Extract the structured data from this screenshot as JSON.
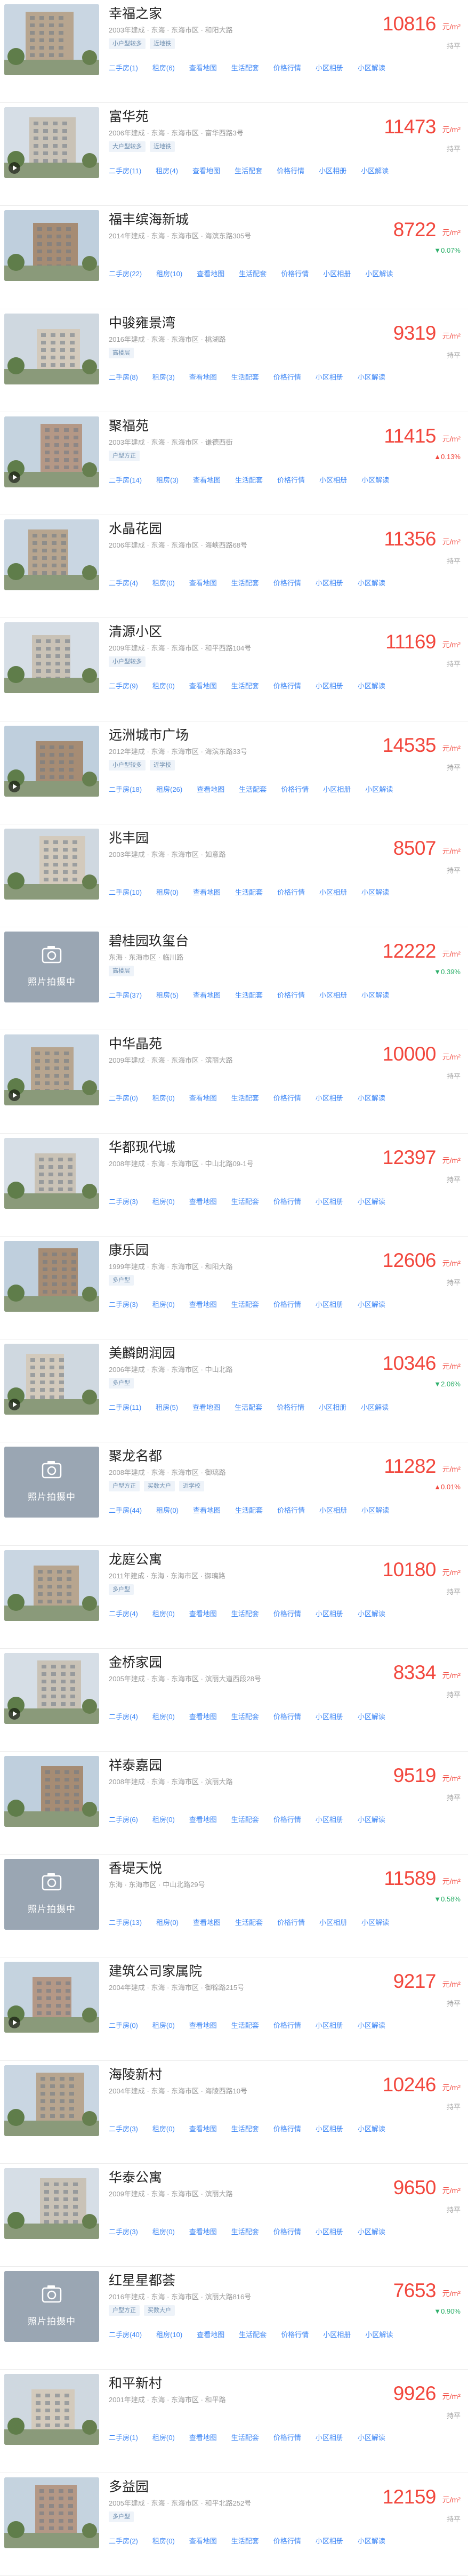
{
  "labels": {
    "unit": "元/m²",
    "trend_flat": "持平",
    "photo_placeholder": "照片拍摄中",
    "links": [
      "二手房",
      "租房",
      "查看地图",
      "生活配套",
      "价格行情",
      "小区相册",
      "小区解读"
    ]
  },
  "colors": {
    "price": "#f2473d",
    "link": "#3f87f5",
    "tag_text": "#6f8fb0",
    "tag_bg": "#eef3f9",
    "trend_down": "#2fb06b"
  },
  "communities": [
    {
      "name": "幸福之家",
      "meta": "2003年建成 · 东海 · 东海市区 · 和阳大路",
      "tags": [
        "小户型较多",
        "近地铁"
      ],
      "price": "10816",
      "trend": "持平",
      "trend_dir": "flat",
      "links": [
        "二手房(1)",
        "租房(6)",
        "查看地图",
        "生活配套",
        "价格行情",
        "小区相册",
        "小区解读"
      ],
      "photo": true
    },
    {
      "name": "富华苑",
      "meta": "2006年建成 · 东海 · 东海市区 · 富华西路3号",
      "tags": [
        "大户型较多",
        "近地铁"
      ],
      "price": "11473",
      "trend": "持平",
      "trend_dir": "flat",
      "links": [
        "二手房(11)",
        "租房(4)",
        "查看地图",
        "生活配套",
        "价格行情",
        "小区相册",
        "小区解读"
      ],
      "photo": true
    },
    {
      "name": "福丰缤海新城",
      "meta": "2014年建成 · 东海 · 东海市区 · 海滨东路305号",
      "tags": [],
      "price": "8722",
      "trend": "▼0.07%",
      "trend_dir": "down",
      "links": [
        "二手房(22)",
        "租房(10)",
        "查看地图",
        "生活配套",
        "价格行情",
        "小区相册",
        "小区解读"
      ],
      "photo": true
    },
    {
      "name": "中骏雍景湾",
      "meta": "2016年建成 · 东海 · 东海市区 · 桃湖路",
      "tags": [
        "高楼层"
      ],
      "price": "9319",
      "trend": "持平",
      "trend_dir": "flat",
      "links": [
        "二手房(8)",
        "租房(3)",
        "查看地图",
        "生活配套",
        "价格行情",
        "小区相册",
        "小区解读"
      ],
      "photo": true
    },
    {
      "name": "聚福苑",
      "meta": "2003年建成 · 东海 · 东海市区 · 谦德西街",
      "tags": [
        "户型方正"
      ],
      "price": "11415",
      "trend": "▲0.13%",
      "trend_dir": "up",
      "links": [
        "二手房(14)",
        "租房(3)",
        "查看地图",
        "生活配套",
        "价格行情",
        "小区相册",
        "小区解读"
      ],
      "photo": true
    },
    {
      "name": "水晶花园",
      "meta": "2006年建成 · 东海 · 东海市区 · 海峡西路68号",
      "tags": [],
      "price": "11356",
      "trend": "持平",
      "trend_dir": "flat",
      "links": [
        "二手房(4)",
        "租房(0)",
        "查看地图",
        "生活配套",
        "价格行情",
        "小区相册",
        "小区解读"
      ],
      "photo": true
    },
    {
      "name": "清源小区",
      "meta": "2009年建成 · 东海 · 东海市区 · 和平西路104号",
      "tags": [
        "小户型较多"
      ],
      "price": "11169",
      "trend": "持平",
      "trend_dir": "flat",
      "links": [
        "二手房(9)",
        "租房(0)",
        "查看地图",
        "生活配套",
        "价格行情",
        "小区相册",
        "小区解读"
      ],
      "photo": true
    },
    {
      "name": "远洲城市广场",
      "meta": "2012年建成 · 东海 · 东海市区 · 海滨东路33号",
      "tags": [
        "小户型较多",
        "近学校"
      ],
      "price": "14535",
      "trend": "持平",
      "trend_dir": "flat",
      "links": [
        "二手房(18)",
        "租房(26)",
        "查看地图",
        "生活配套",
        "价格行情",
        "小区相册",
        "小区解读"
      ],
      "photo": true
    },
    {
      "name": "兆丰园",
      "meta": "2003年建成 · 东海 · 东海市区 · 如意路",
      "tags": [],
      "price": "8507",
      "trend": "持平",
      "trend_dir": "flat",
      "links": [
        "二手房(10)",
        "租房(0)",
        "查看地图",
        "生活配套",
        "价格行情",
        "小区相册",
        "小区解读"
      ],
      "photo": true
    },
    {
      "name": "碧桂园玖玺台",
      "meta": "东海 · 东海市区 · 临川路",
      "tags": [
        "高楼层"
      ],
      "price": "12222",
      "trend": "▼0.39%",
      "trend_dir": "down",
      "links": [
        "二手房(37)",
        "租房(5)",
        "查看地图",
        "生活配套",
        "价格行情",
        "小区相册",
        "小区解读"
      ],
      "photo": false
    },
    {
      "name": "中华晶苑",
      "meta": "2009年建成 · 东海 · 东海市区 · 滨丽大路",
      "tags": [],
      "price": "10000",
      "trend": "持平",
      "trend_dir": "flat",
      "links": [
        "二手房(0)",
        "租房(0)",
        "查看地图",
        "生活配套",
        "价格行情",
        "小区相册",
        "小区解读"
      ],
      "photo": true
    },
    {
      "name": "华都现代城",
      "meta": "2008年建成 · 东海 · 东海市区 · 中山北路09-1号",
      "tags": [],
      "price": "12397",
      "trend": "持平",
      "trend_dir": "flat",
      "links": [
        "二手房(3)",
        "租房(0)",
        "查看地图",
        "生活配套",
        "价格行情",
        "小区相册",
        "小区解读"
      ],
      "photo": true
    },
    {
      "name": "康乐园",
      "meta": "1999年建成 · 东海 · 东海市区 · 和阳大路",
      "tags": [
        "多户型"
      ],
      "price": "12606",
      "trend": "持平",
      "trend_dir": "flat",
      "links": [
        "二手房(3)",
        "租房(0)",
        "查看地图",
        "生活配套",
        "价格行情",
        "小区相册",
        "小区解读"
      ],
      "photo": true
    },
    {
      "name": "美麟朗润园",
      "meta": "2006年建成 · 东海 · 东海市区 · 中山北路",
      "tags": [
        "多户型"
      ],
      "price": "10346",
      "trend": "▼2.06%",
      "trend_dir": "down",
      "links": [
        "二手房(11)",
        "租房(5)",
        "查看地图",
        "生活配套",
        "价格行情",
        "小区相册",
        "小区解读"
      ],
      "photo": true
    },
    {
      "name": "聚龙名都",
      "meta": "2008年建成 · 东海 · 东海市区 · 御璃路",
      "tags": [
        "户型方正",
        "买数大户",
        "近学校"
      ],
      "price": "11282",
      "trend": "▲0.01%",
      "trend_dir": "up",
      "links": [
        "二手房(44)",
        "租房(0)",
        "查看地图",
        "生活配套",
        "价格行情",
        "小区相册",
        "小区解读"
      ],
      "photo": false
    },
    {
      "name": "龙庭公寓",
      "meta": "2011年建成 · 东海 · 东海市区 · 御璃路",
      "tags": [
        "多户型"
      ],
      "price": "10180",
      "trend": "持平",
      "trend_dir": "flat",
      "links": [
        "二手房(4)",
        "租房(0)",
        "查看地图",
        "生活配套",
        "价格行情",
        "小区相册",
        "小区解读"
      ],
      "photo": true
    },
    {
      "name": "金桥家园",
      "meta": "2005年建成 · 东海 · 东海市区 · 滨丽大道西段28号",
      "tags": [],
      "price": "8334",
      "trend": "持平",
      "trend_dir": "flat",
      "links": [
        "二手房(4)",
        "租房(0)",
        "查看地图",
        "生活配套",
        "价格行情",
        "小区相册",
        "小区解读"
      ],
      "photo": true
    },
    {
      "name": "祥泰嘉园",
      "meta": "2008年建成 · 东海 · 东海市区 · 滨丽大路",
      "tags": [],
      "price": "9519",
      "trend": "持平",
      "trend_dir": "flat",
      "links": [
        "二手房(6)",
        "租房(0)",
        "查看地图",
        "生活配套",
        "价格行情",
        "小区相册",
        "小区解读"
      ],
      "photo": true
    },
    {
      "name": "香堤天悦",
      "meta": "东海 · 东海市区 · 中山北路29号",
      "tags": [],
      "price": "11589",
      "trend": "▼0.58%",
      "trend_dir": "down",
      "links": [
        "二手房(13)",
        "租房(0)",
        "查看地图",
        "生活配套",
        "价格行情",
        "小区相册",
        "小区解读"
      ],
      "photo": false
    },
    {
      "name": "建筑公司家属院",
      "meta": "2004年建成 · 东海 · 东海市区 · 御锦路215号",
      "tags": [],
      "price": "9217",
      "trend": "持平",
      "trend_dir": "flat",
      "links": [
        "二手房(0)",
        "租房(0)",
        "查看地图",
        "生活配套",
        "价格行情",
        "小区相册",
        "小区解读"
      ],
      "photo": true
    },
    {
      "name": "海陵新村",
      "meta": "2004年建成 · 东海 · 东海市区 · 海陵西路10号",
      "tags": [],
      "price": "10246",
      "trend": "持平",
      "trend_dir": "flat",
      "links": [
        "二手房(3)",
        "租房(0)",
        "查看地图",
        "生活配套",
        "价格行情",
        "小区相册",
        "小区解读"
      ],
      "photo": true
    },
    {
      "name": "华泰公寓",
      "meta": "2009年建成 · 东海 · 东海市区 · 滨丽大路",
      "tags": [],
      "price": "9650",
      "trend": "持平",
      "trend_dir": "flat",
      "links": [
        "二手房(3)",
        "租房(0)",
        "查看地图",
        "生活配套",
        "价格行情",
        "小区相册",
        "小区解读"
      ],
      "photo": true
    },
    {
      "name": "红星星都荟",
      "meta": "2016年建成 · 东海 · 东海市区 · 滨丽大路816号",
      "tags": [
        "户型方正",
        "买数大户"
      ],
      "price": "7653",
      "trend": "▼0.90%",
      "trend_dir": "down",
      "links": [
        "二手房(40)",
        "租房(10)",
        "查看地图",
        "生活配套",
        "价格行情",
        "小区相册",
        "小区解读"
      ],
      "photo": false
    },
    {
      "name": "和平新村",
      "meta": "2001年建成 · 东海 · 东海市区 · 和平路",
      "tags": [],
      "price": "9926",
      "trend": "持平",
      "trend_dir": "flat",
      "links": [
        "二手房(1)",
        "租房(0)",
        "查看地图",
        "生活配套",
        "价格行情",
        "小区相册",
        "小区解读"
      ],
      "photo": true
    },
    {
      "name": "多益园",
      "meta": "2005年建成 · 东海 · 东海市区 · 和平北路252号",
      "tags": [
        "多户型"
      ],
      "price": "12159",
      "trend": "持平",
      "trend_dir": "flat",
      "links": [
        "二手房(2)",
        "租房(0)",
        "查看地图",
        "生活配套",
        "价格行情",
        "小区相册",
        "小区解读"
      ],
      "photo": true
    }
  ]
}
